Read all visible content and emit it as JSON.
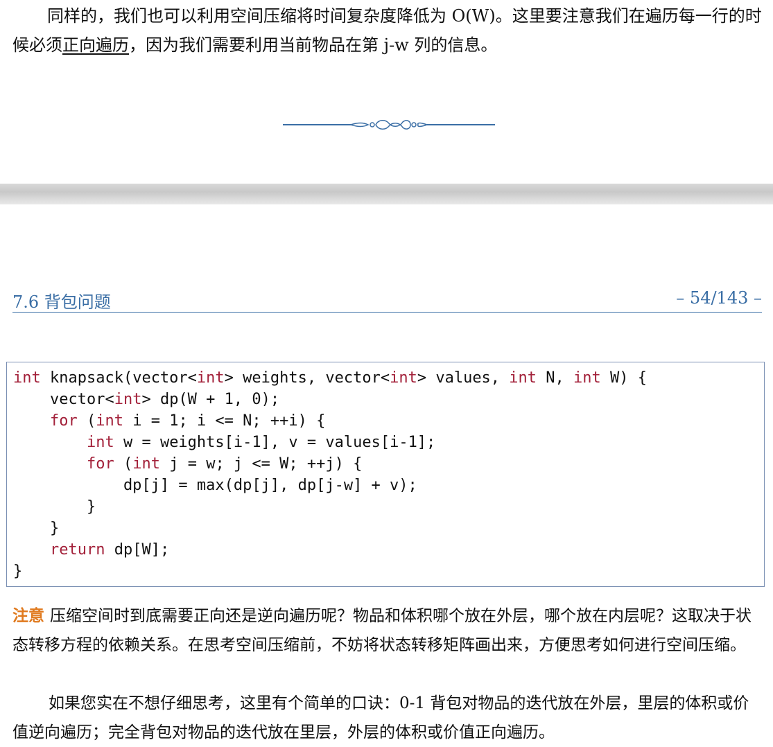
{
  "para1": {
    "before": "同样的，我们也可以利用空间压缩将时间复杂度降低为 O(W)。这里要注意我们在遍历每一行的时候必须",
    "underlined": "正向遍历",
    "after": "，因为我们需要利用当前物品在第 j-w 列的信息。"
  },
  "header": {
    "section": "7.6 背包问题",
    "page": "– 54/143 –"
  },
  "code": [
    [
      {
        "t": "int",
        "k": 1
      },
      {
        "t": " knapsack(vector<"
      },
      {
        "t": "int",
        "k": 1
      },
      {
        "t": "> weights, vector<"
      },
      {
        "t": "int",
        "k": 1
      },
      {
        "t": "> values, "
      },
      {
        "t": "int",
        "k": 1
      },
      {
        "t": " N, "
      },
      {
        "t": "int",
        "k": 1
      },
      {
        "t": " W) {"
      }
    ],
    [
      {
        "t": "    vector<"
      },
      {
        "t": "int",
        "k": 1
      },
      {
        "t": "> dp(W + 1, 0);"
      }
    ],
    [
      {
        "t": "    "
      },
      {
        "t": "for",
        "k": 1
      },
      {
        "t": " ("
      },
      {
        "t": "int",
        "k": 1
      },
      {
        "t": " i = 1; i <= N; ++i) {"
      }
    ],
    [
      {
        "t": "        "
      },
      {
        "t": "int",
        "k": 1
      },
      {
        "t": " w = weights[i-1], v = values[i-1];"
      }
    ],
    [
      {
        "t": "        "
      },
      {
        "t": "for",
        "k": 1
      },
      {
        "t": " ("
      },
      {
        "t": "int",
        "k": 1
      },
      {
        "t": " j = w; j <= W; ++j) {"
      }
    ],
    [
      {
        "t": "            dp[j] = max(dp[j], dp[j-w] + v);"
      }
    ],
    [
      {
        "t": "        }"
      }
    ],
    [
      {
        "t": "    }"
      }
    ],
    [
      {
        "t": "    "
      },
      {
        "t": "return",
        "k": 1
      },
      {
        "t": " dp[W];"
      }
    ],
    [
      {
        "t": "}"
      }
    ]
  ],
  "note": {
    "label": "注意",
    "text": "压缩空间时到底需要正向还是逆向遍历呢？物品和体积哪个放在外层，哪个放在内层呢？这取决于状态转移方程的依赖关系。在思考空间压缩前，不妨将状态转移矩阵画出来，方便思考如何进行空间压缩。"
  },
  "para2": "如果您实在不想仔细思考，这里有个简单的口诀：0-1 背包对物品的迭代放在外层，里层的体积或价值逆向遍历；完全背包对物品的迭代放在里层，外层的体积或价值正向遍历。",
  "colors": {
    "accent": "#3a6ea5",
    "keyword": "#a3213a",
    "note_label": "#e07a1f"
  },
  "icons": {
    "divider": "ornamental-divider-icon"
  }
}
